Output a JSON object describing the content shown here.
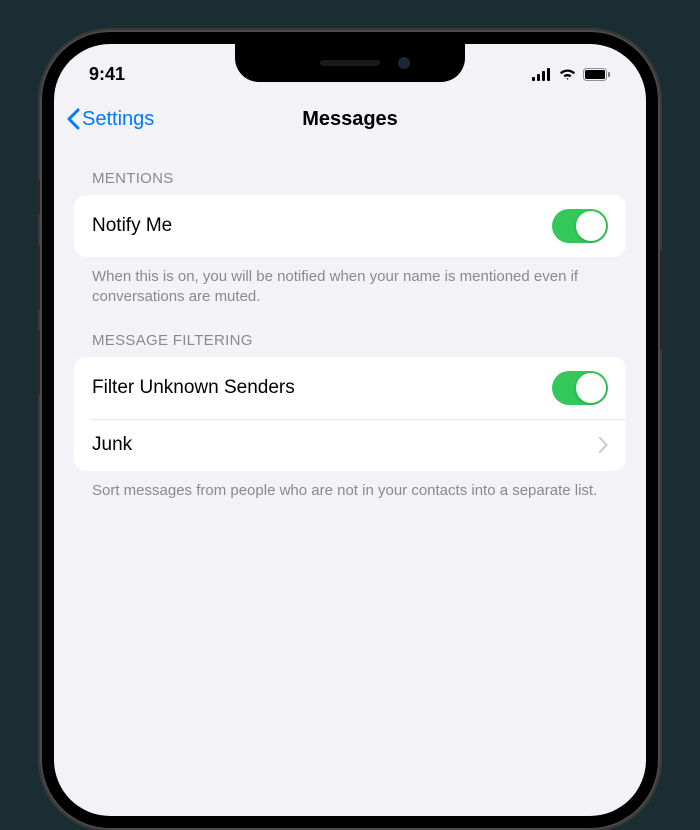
{
  "statusBar": {
    "time": "9:41"
  },
  "nav": {
    "back": "Settings",
    "title": "Messages"
  },
  "sections": {
    "mentions": {
      "header": "MENTIONS",
      "notifyMe": "Notify Me",
      "footer": "When this is on, you will be notified when your name is mentioned even if conversations are muted."
    },
    "filtering": {
      "header": "MESSAGE FILTERING",
      "filterUnknown": "Filter Unknown Senders",
      "junk": "Junk",
      "footer": "Sort messages from people who are not in your contacts into a separate list."
    }
  },
  "toggles": {
    "notifyMe": true,
    "filterUnknown": true
  }
}
